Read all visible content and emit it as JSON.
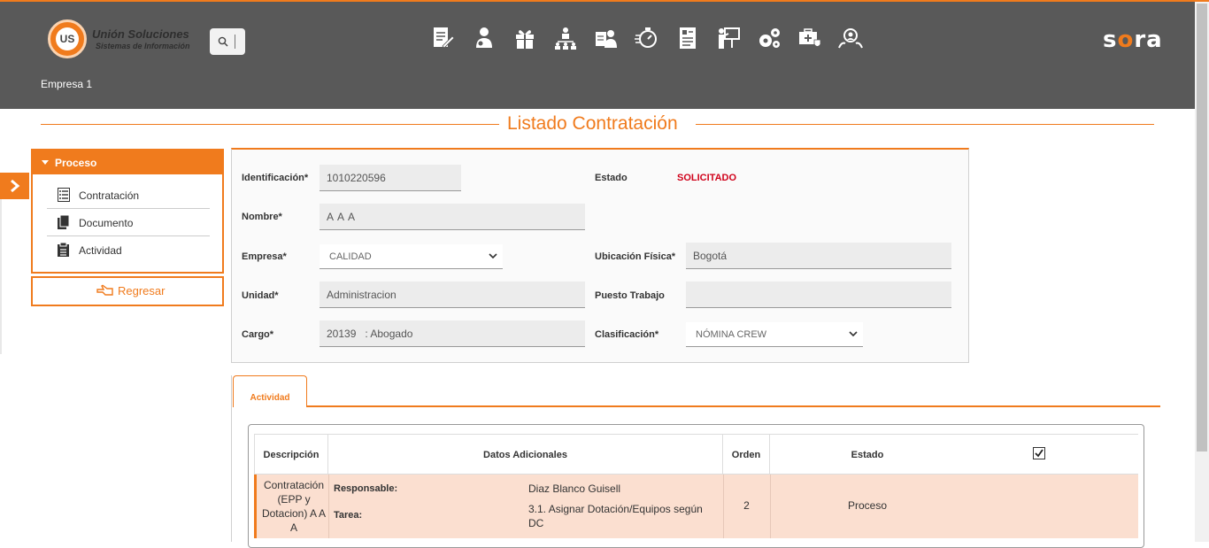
{
  "header": {
    "logo_title": "Unión Soluciones",
    "logo_sub": "Sistemas de Información",
    "logo_badge": "US",
    "brand": "sora",
    "brand_pre": "s",
    "brand_o": "o",
    "brand_post": "ra",
    "company": "Empresa 1",
    "modules": [
      "document-edit-icon",
      "person-doctor-icon",
      "gift-icon",
      "org-chart-icon",
      "person-card-icon",
      "timer-icon",
      "report-list-icon",
      "presentation-icon",
      "gears-icon",
      "medical-bag-icon",
      "people-search-icon"
    ]
  },
  "page": {
    "title": "Listado Contratación"
  },
  "sidebar": {
    "panel_title": "Proceso",
    "items": [
      {
        "label": "Contratación",
        "icon": "list-icon"
      },
      {
        "label": "Documento",
        "icon": "documents-icon"
      },
      {
        "label": "Actividad",
        "icon": "clipboard-icon"
      }
    ],
    "back_label": "Regresar"
  },
  "form": {
    "identificacion_label": "Identificación*",
    "identificacion_value": "1010220596",
    "estado_label": "Estado",
    "estado_value": "SOLICITADO",
    "nombre_label": "Nombre*",
    "nombre_value": "A A A",
    "empresa_label": "Empresa*",
    "empresa_value": "CALIDAD",
    "ubicacion_label": "Ubicación Física*",
    "ubicacion_value": "Bogotá",
    "unidad_label": "Unidad*",
    "unidad_value": "Administracion",
    "puesto_label": "Puesto Trabajo",
    "puesto_value": "",
    "cargo_label": "Cargo*",
    "cargo_value": "20139   : Abogado",
    "clasificacion_label": "Clasificación*",
    "clasificacion_value": "NÓMINA CREW"
  },
  "tabs": [
    {
      "label": "Actividad",
      "active": true
    }
  ],
  "table": {
    "columns": [
      "Descripción",
      "Datos Adicionales",
      "Orden",
      "Estado"
    ],
    "header_checkbox_checked": true,
    "rows": [
      {
        "descripcion": "Contratación (EPP y Dotacion) A A A",
        "responsable_label": "Responsable:",
        "responsable": "Diaz Blanco Guisell",
        "tarea_label": "Tarea:",
        "tarea": "3.1. Asignar Dotación/Equipos según DC",
        "orden": "2",
        "estado": "Proceso"
      }
    ]
  },
  "colors": {
    "accent": "#f07b1d",
    "header_bg": "#595959",
    "status_red": "#d0021b",
    "row_highlight": "#fbdfd0"
  }
}
